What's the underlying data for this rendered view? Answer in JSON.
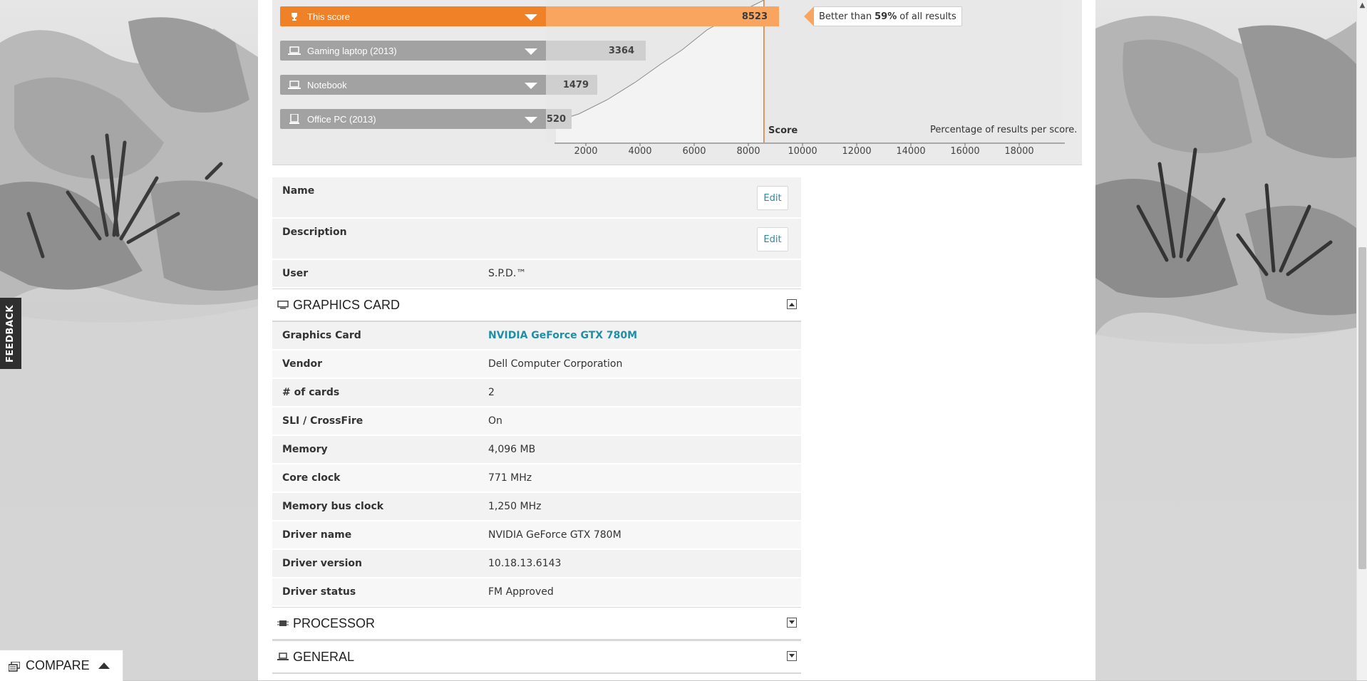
{
  "score_bars": [
    {
      "label": "This score",
      "value": "8523",
      "icon": "trophy-icon"
    },
    {
      "label": "Gaming laptop (2013)",
      "value": "3364",
      "icon": "laptop-icon"
    },
    {
      "label": "Notebook",
      "value": "1479",
      "icon": "laptop-icon"
    },
    {
      "label": "Office PC (2013)",
      "value": "520",
      "icon": "desktop-icon"
    }
  ],
  "tooltip": {
    "prefix": "Better than",
    "percent": "59%",
    "suffix": "of all results"
  },
  "chart": {
    "score_label": "Score",
    "caption": "Percentage of results per score.",
    "ticks": [
      "2000",
      "4000",
      "6000",
      "8000",
      "10000",
      "12000",
      "14000",
      "16000",
      "18000"
    ]
  },
  "chart_data": {
    "type": "area",
    "title": "",
    "xlabel": "Score",
    "ylabel": "Percentage of results per score.",
    "x": [
      1000,
      2000,
      3000,
      4000,
      5000,
      6000,
      7000,
      8000,
      8523,
      9000
    ],
    "xlim": [
      800,
      19600
    ],
    "marker_score": 8523
  },
  "details": {
    "name_label": "Name",
    "description_label": "Description",
    "edit_label": "Edit",
    "user_label": "User",
    "user_value": "S.P.D.™"
  },
  "graphics_card": {
    "title": "GRAPHICS CARD",
    "rows": [
      {
        "key": "Graphics Card",
        "value": "NVIDIA GeForce GTX 780M"
      },
      {
        "key": "Vendor",
        "value": "Dell Computer Corporation"
      },
      {
        "key": "# of cards",
        "value": "2"
      },
      {
        "key": "SLI / CrossFire",
        "value": "On"
      },
      {
        "key": "Memory",
        "value": "4,096 MB"
      },
      {
        "key": "Core clock",
        "value": "771 MHz"
      },
      {
        "key": "Memory bus clock",
        "value": "1,250 MHz"
      },
      {
        "key": "Driver name",
        "value": "NVIDIA GeForce GTX 780M"
      },
      {
        "key": "Driver version",
        "value": "10.18.13.6143"
      },
      {
        "key": "Driver status",
        "value": "FM Approved"
      }
    ]
  },
  "processor": {
    "title": "PROCESSOR"
  },
  "general": {
    "title": "GENERAL"
  },
  "feedback": {
    "label": "FEEDBACK"
  },
  "compare": {
    "label": "COMPARE"
  },
  "colors": {
    "accent": "#f08127",
    "accent_light": "#f9a560",
    "link": "#1e8fa6",
    "grey_bar": "#a2a2a2"
  }
}
